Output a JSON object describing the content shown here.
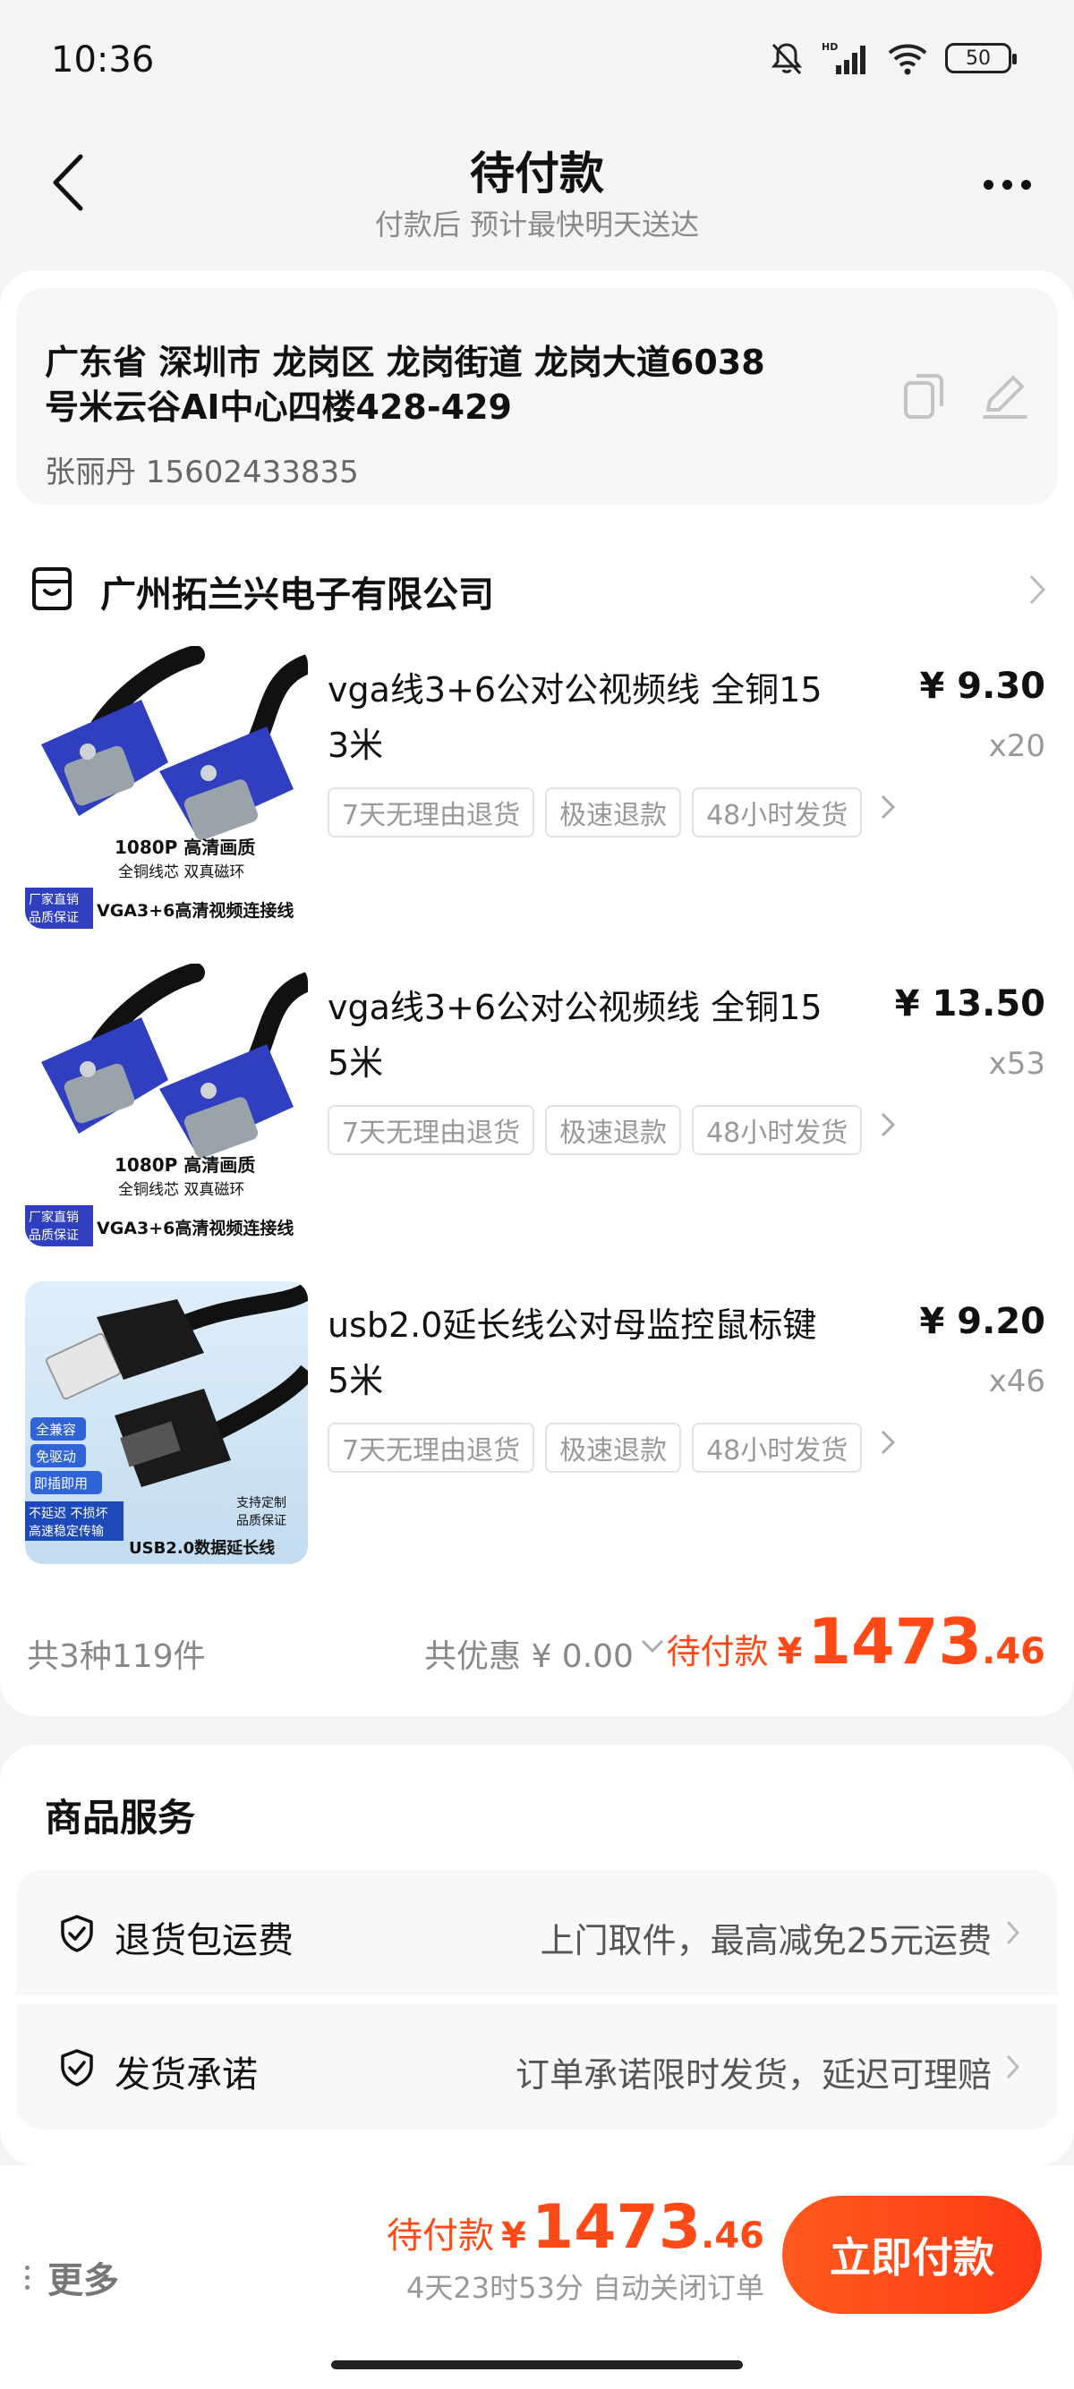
{
  "status_bar": {
    "time": "10:36",
    "battery": "50"
  },
  "header": {
    "title": "待付款",
    "subtitle": "付款后 预计最快明天送达"
  },
  "address": {
    "line1": "广东省 深圳市 龙岗区 龙岗街道 龙岗大道6038",
    "line2": "号米云谷AI中心四楼428-429",
    "contact": "张丽丹 15602433835"
  },
  "shop": {
    "name": "广州拓兰兴电子有限公司"
  },
  "products": [
    {
      "title_line1": "vga线3+6公对公视频线 全铜15",
      "title_line2": "3米",
      "price": "¥ 9.30",
      "qty": "x20",
      "tags": [
        "7天无理由退货",
        "极速退款",
        "48小时发货"
      ],
      "thumb": {
        "line1": "1080P  高清画质",
        "line2": "全铜线芯  双真磁环",
        "badge1": "厂家直销",
        "badge2": "品质保证",
        "banner": "VGA3+6高清视频连接线"
      }
    },
    {
      "title_line1": "vga线3+6公对公视频线 全铜15",
      "title_line2": "5米",
      "price": "¥ 13.50",
      "qty": "x53",
      "tags": [
        "7天无理由退货",
        "极速退款",
        "48小时发货"
      ],
      "thumb": {
        "line1": "1080P  高清画质",
        "line2": "全铜线芯  双真磁环",
        "badge1": "厂家直销",
        "badge2": "品质保证",
        "banner": "VGA3+6高清视频连接线"
      }
    },
    {
      "title_line1": "usb2.0延长线公对母监控鼠标键",
      "title_line2": "5米",
      "price": "¥ 9.20",
      "qty": "x46",
      "tags": [
        "7天无理由退货",
        "极速退款",
        "48小时发货"
      ],
      "thumb": {
        "chip1": "全兼容",
        "chip2": "免驱动",
        "chip3": "即插即用",
        "line1": "不延迟 不损坏",
        "line2": "高速稳定传输",
        "side1": "支持定制",
        "side2": "品质保证",
        "banner": "USB2.0数据延长线"
      }
    }
  ],
  "summary": {
    "count": "共3种119件",
    "discount": "共优惠 ¥ 0.00",
    "total_label": "待付款",
    "yen": "¥",
    "total_int": "1473",
    "total_dec": ".46"
  },
  "services": {
    "title": "商品服务",
    "items": [
      {
        "label": "退货包运费",
        "value": "上门取件，最高减免25元运费"
      },
      {
        "label": "发货承诺",
        "value": "订单承诺限时发货，延迟可理赔"
      }
    ]
  },
  "bottom_bar": {
    "more": "更多",
    "total_label": "待付款",
    "yen": "¥",
    "total_int": "1473",
    "total_dec": ".46",
    "auto_close": "4天23时53分 自动关闭订单",
    "pay_button": "立即付款"
  },
  "colors": {
    "accent": "#ff4a17",
    "button": "#ff4214",
    "connector_blue": "#2f3fbf"
  }
}
